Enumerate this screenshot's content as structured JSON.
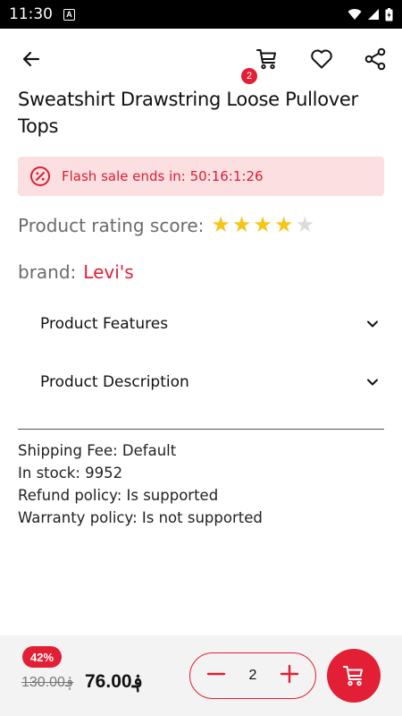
{
  "status_bar": {
    "time": "11:30",
    "notification_glyph": "A"
  },
  "header": {
    "cart_badge_count": "2"
  },
  "product": {
    "title": "Sweatshirt Drawstring Loose Pullover Tops",
    "flash_sale_text": "Flash sale ends in: 50:16:1:26",
    "rating_label": "Product rating score:",
    "rating_value": 4,
    "rating_max": 5,
    "brand_label": "brand:",
    "brand_value": "Levi's"
  },
  "accordions": [
    {
      "label": "Product Features"
    },
    {
      "label": "Product Description"
    }
  ],
  "info": {
    "shipping": "Shipping Fee: Default",
    "stock": "In stock: 9952",
    "refund": "Refund policy: Is supported",
    "warranty": "Warranty policy: Is not supported"
  },
  "footer": {
    "discount": "42%",
    "old_price": "130.00؋",
    "new_price": "76.00؋",
    "quantity": "2"
  },
  "colors": {
    "accent": "#e21f34",
    "flash_bg": "#fcdfe1",
    "star_filled": "#f5c518",
    "star_empty": "#dcdcdc"
  }
}
